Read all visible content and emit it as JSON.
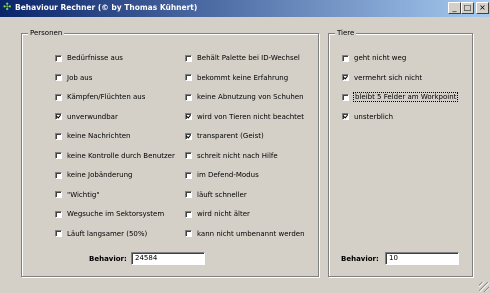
{
  "window": {
    "title": "Behaviour Rechner (© by Thomas Kühnert)",
    "minimize": "_",
    "maximize": "□",
    "close": "×"
  },
  "personen": {
    "legend": "Personen",
    "left_items": [
      {
        "label": "Bedürfnisse aus",
        "checked": false
      },
      {
        "label": "Job aus",
        "checked": false
      },
      {
        "label": "Kämpfen/Flüchten aus",
        "checked": false
      },
      {
        "label": "unverwundbar",
        "checked": true
      },
      {
        "label": "keine Nachrichten",
        "checked": false
      },
      {
        "label": "keine Kontrolle durch Benutzer",
        "checked": false
      },
      {
        "label": "keine Jobänderung",
        "checked": false
      },
      {
        "label": "\"Wichtig\"",
        "checked": false
      },
      {
        "label": "Wegsuche im Sektorsystem",
        "checked": false
      },
      {
        "label": "Läuft langsamer (50%)",
        "checked": false
      }
    ],
    "right_items": [
      {
        "label": "Behält Palette bei ID-Wechsel",
        "checked": false
      },
      {
        "label": "bekommt keine Erfahrung",
        "checked": false
      },
      {
        "label": "keine Abnutzung von Schuhen",
        "checked": false
      },
      {
        "label": "wird von Tieren nicht beachtet",
        "checked": true
      },
      {
        "label": "transparent (Geist)",
        "checked": true
      },
      {
        "label": "schreit nicht nach Hilfe",
        "checked": false
      },
      {
        "label": "im Defend-Modus",
        "checked": false
      },
      {
        "label": "läuft schneller",
        "checked": false
      },
      {
        "label": "wird nicht älter",
        "checked": false
      },
      {
        "label": "kann nicht umbenannt werden",
        "checked": false
      }
    ],
    "behavior_label": "Behavior:",
    "behavior_value": "24584"
  },
  "tiere": {
    "legend": "Tiere",
    "items": [
      {
        "label": "geht nicht weg",
        "checked": false
      },
      {
        "label": "vermehrt sich nicht",
        "checked": true
      },
      {
        "label": "bleibt 5 Felder am Workpoint",
        "checked": false
      },
      {
        "label": "unsterblich",
        "checked": true
      }
    ],
    "behavior_label": "Behavior:",
    "behavior_value": "10"
  }
}
